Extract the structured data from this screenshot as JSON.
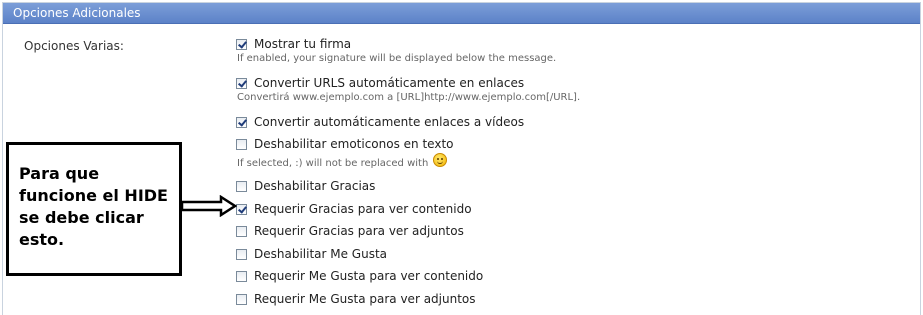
{
  "panel": {
    "title": "Opciones Adicionales"
  },
  "section": {
    "label": "Opciones Varias:"
  },
  "options": [
    {
      "label": "Mostrar tu firma",
      "checked": true,
      "description": "If enabled, your signature will be displayed below the message."
    },
    {
      "label": "Convertir URLS automáticamente en enlaces",
      "checked": true,
      "description": "Convertirá www.ejemplo.com a [URL]http://www.ejemplo.com[/URL]."
    },
    {
      "label": "Convertir automáticamente enlaces a vídeos",
      "checked": true
    },
    {
      "label": "Deshabilitar emoticonos en texto",
      "checked": false,
      "description": "If selected, :) will not be replaced with"
    },
    {
      "label": "Deshabilitar Gracias",
      "checked": false
    },
    {
      "label": "Requerir Gracias para ver contenido",
      "checked": true
    },
    {
      "label": "Requerir Gracias para ver adjuntos",
      "checked": false
    },
    {
      "label": "Deshabilitar Me Gusta",
      "checked": false
    },
    {
      "label": "Requerir Me Gusta para ver contenido",
      "checked": false
    },
    {
      "label": "Requerir Me Gusta para ver adjuntos",
      "checked": false
    }
  ],
  "annotation": {
    "text": "Para que\nfuncione el HIDE\nse debe clicar\nesto."
  },
  "icons": {
    "smiley": "smiley-emoticon-icon",
    "arrow": "right-arrow-icon"
  }
}
